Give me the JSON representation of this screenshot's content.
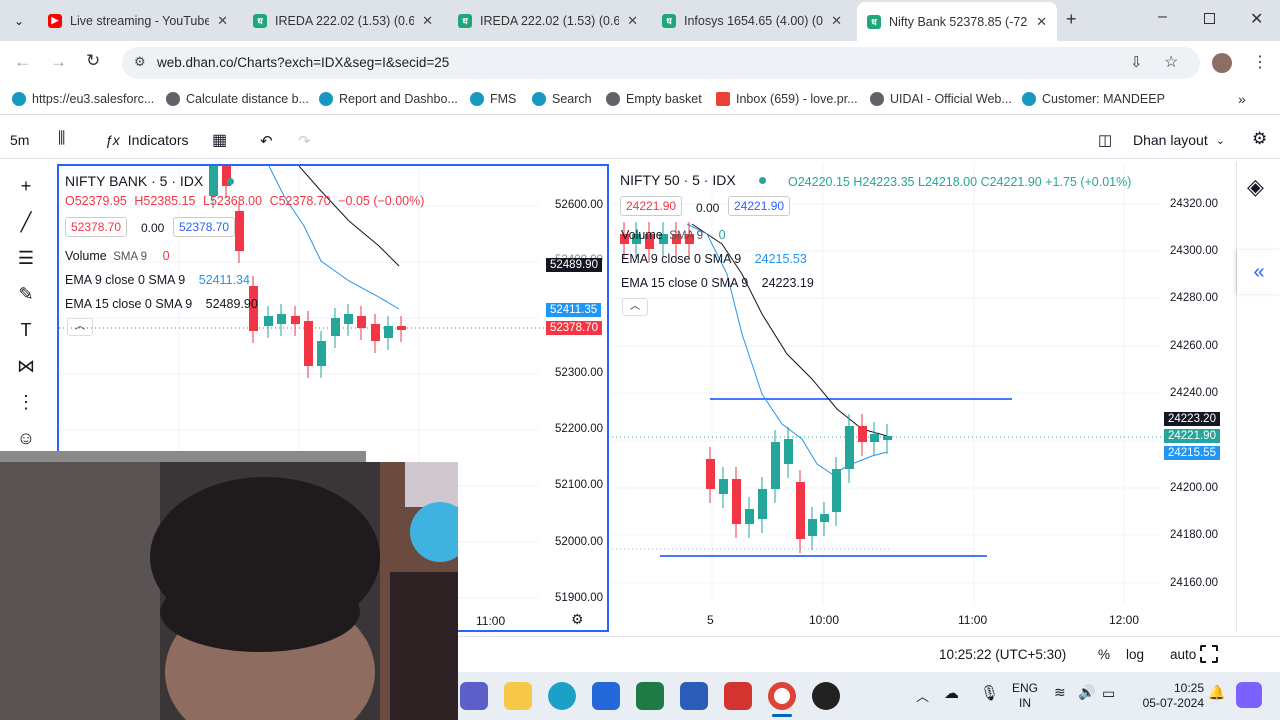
{
  "browser": {
    "tabs": [
      {
        "title": "Live streaming - YouTube",
        "favicon_color": "#ff0000",
        "active": false
      },
      {
        "title": "IREDA 222.02 (1.53) (0.69",
        "favicon_color": "#1fa67a",
        "active": false
      },
      {
        "title": "IREDA 222.02 (1.53) (0.69",
        "favicon_color": "#1fa67a",
        "active": false
      },
      {
        "title": "Infosys 1654.65 (4.00) (0.",
        "favicon_color": "#1fa67a",
        "active": false
      },
      {
        "title": "Nifty Bank 52378.85 (-72.",
        "favicon_color": "#1fa67a",
        "active": true
      }
    ],
    "url": "web.dhan.co/Charts?exch=IDX&seg=I&secid=25",
    "bookmarks": [
      {
        "label": "https://eu3.salesforc...",
        "color": "#1798c1"
      },
      {
        "label": "Calculate distance b...",
        "color": "#5f6368"
      },
      {
        "label": "Report and Dashbo...",
        "color": "#1798c1"
      },
      {
        "label": "FMS",
        "color": "#1798c1"
      },
      {
        "label": "Search",
        "color": "#1798c1"
      },
      {
        "label": "Empty basket",
        "color": "#5f6368"
      },
      {
        "label": "Inbox (659) - love.pr...",
        "color": "#ea4335"
      },
      {
        "label": "UIDAI - Official Web...",
        "color": "#5f6368"
      },
      {
        "label": "Customer: MANDEEP",
        "color": "#1798c1"
      }
    ]
  },
  "chart_toolbar": {
    "interval": "5m",
    "indicators_label": "Indicators",
    "layout_label": "Dhan layout"
  },
  "left_pane": {
    "title": "NIFTY BANK · 5 · IDX",
    "ohlc": {
      "o": "O52379.95",
      "h": "H52385.15",
      "l": "L52368.00",
      "c": "C52378.70",
      "chg": "−0.05 (−0.00%)"
    },
    "bid": "52378.70",
    "spread": "0.00",
    "ask": "52378.70",
    "volume_label": "Volume",
    "volume_params": "SMA 9",
    "volume_value": "0",
    "ema9_label": "EMA 9 close 0 SMA 9",
    "ema9_value": "52411.34",
    "ema15_label": "EMA 15 close 0 SMA 9",
    "ema15_value": "52489.90",
    "price_scale": [
      "52600.00",
      "52400.00",
      "52300.00",
      "52200.00",
      "52100.00",
      "52000.00",
      "51900.00"
    ],
    "badges": [
      {
        "text": "52489.90",
        "color": "#131722"
      },
      {
        "text": "52411.35",
        "color": "#2196f3"
      },
      {
        "text": "52378.70",
        "color": "#f23645"
      }
    ],
    "time_label": "11:00"
  },
  "right_pane": {
    "title": "NIFTY 50 · 5 · IDX",
    "ohlc": {
      "o": "O24220.15",
      "h": "H24223.35",
      "l": "L24218.00",
      "c": "C24221.90",
      "chg": "+1.75 (+0.01%)"
    },
    "bid": "24221.90",
    "spread": "0.00",
    "ask": "24221.90",
    "volume_label": "Volume",
    "volume_params": "SMA 9",
    "volume_value": "0",
    "ema9_label": "EMA 9 close 0 SMA 9",
    "ema9_value": "24215.53",
    "ema15_label": "EMA 15 close 0 SMA 9",
    "ema15_value": "24223.19",
    "price_scale": [
      "24320.00",
      "24300.00",
      "24280.00",
      "24260.00",
      "24240.00",
      "24200.00",
      "24180.00",
      "24160.00"
    ],
    "badges": [
      {
        "text": "24223.20",
        "color": "#131722"
      },
      {
        "text": "24221.90",
        "color": "#26a69a"
      },
      {
        "text": "24215.55",
        "color": "#2196f3"
      }
    ],
    "time_labels": [
      "5",
      "10:00",
      "11:00",
      "12:00"
    ]
  },
  "bottom_bar": {
    "clock": "10:25:22 (UTC+5:30)",
    "percent_label": "%",
    "log_label": "log",
    "auto_label": "auto"
  },
  "taskbar": {
    "lang_line1": "ENG",
    "lang_line2": "IN",
    "time": "10:25",
    "date": "05-07-2024"
  },
  "colors": {
    "up": "#26a69a",
    "down": "#f23645",
    "ema9": "#2196f3",
    "ema15": "#131722",
    "accent": "#2962ff"
  }
}
